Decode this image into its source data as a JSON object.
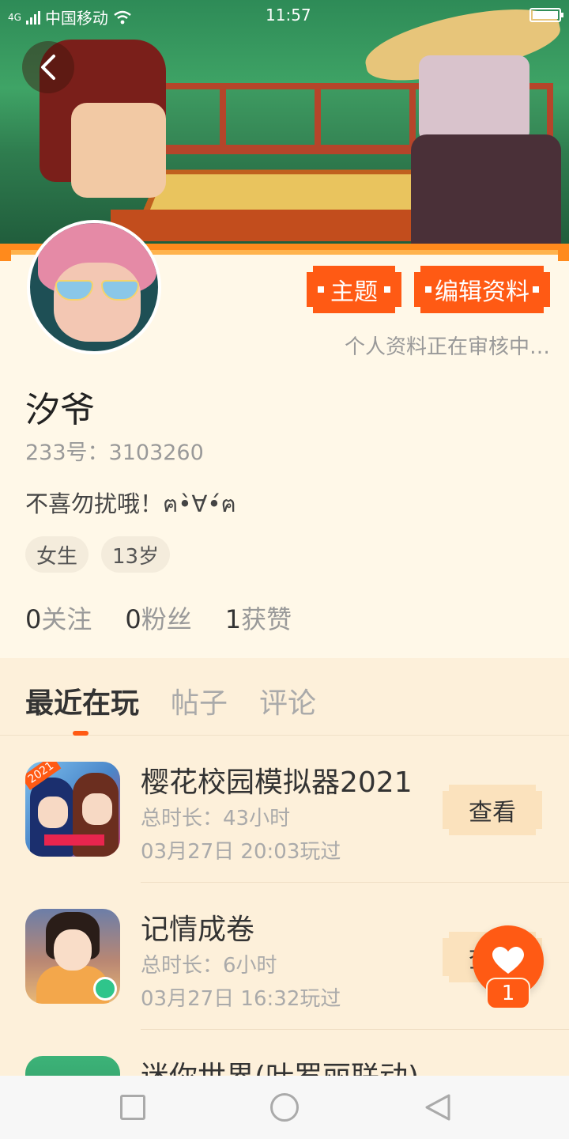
{
  "status_bar": {
    "network": "4G",
    "carrier": "中国移动",
    "time": "11:57"
  },
  "header": {
    "back_icon": "chevron-left-icon"
  },
  "profile": {
    "theme_label": "主题",
    "edit_label": "编辑资料",
    "review_note": "个人资料正在审核中…",
    "username": "汐爷",
    "uid_text": "233号：3103260",
    "bio": "不喜勿扰哦！ฅ•̀∀•́ฅ",
    "tags": [
      "女生",
      "13岁"
    ],
    "stats": [
      {
        "value": "0",
        "label": "关注"
      },
      {
        "value": "0",
        "label": "粉丝"
      },
      {
        "value": "1",
        "label": "获赞"
      }
    ]
  },
  "tabs": [
    "最近在玩",
    "帖子",
    "评论"
  ],
  "games": [
    {
      "title": "樱花校园模拟器2021",
      "duration": "总时长：43小时",
      "last_played": "03月27日 20:03玩过",
      "action": "查看",
      "icon_badge": "2021"
    },
    {
      "title": "记情成卷",
      "duration": "总时长：6小时",
      "last_played": "03月27日 16:32玩过",
      "action": "查看"
    },
    {
      "title": "迷你世界(叶罗丽联动)"
    }
  ],
  "like": {
    "count": "1",
    "icon": "heart-icon"
  },
  "colors": {
    "accent": "#ff5a14",
    "page_bg": "#fff8e8",
    "list_bg": "#fdf0da"
  }
}
